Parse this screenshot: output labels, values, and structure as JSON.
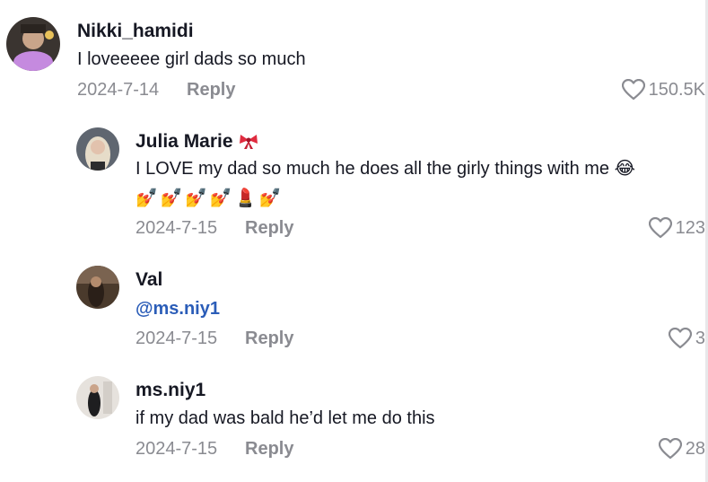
{
  "comments": [
    {
      "username": "Nikki_hamidi",
      "text": "I loveeeee girl dads so much",
      "date": "2024-7-14",
      "reply_label": "Reply",
      "likes": "150.5K"
    },
    {
      "username": "Julia Marie",
      "text_line1": "I LOVE my dad so much he does all the girly things with me 😂",
      "emoji_row": [
        "💅",
        "💅",
        "💅",
        "💅",
        "💄",
        "💅"
      ],
      "date": "2024-7-15",
      "reply_label": "Reply",
      "likes": "123"
    },
    {
      "username": "Val",
      "mention": "@ms.niy1",
      "date": "2024-7-15",
      "reply_label": "Reply",
      "likes": "3"
    },
    {
      "username": "ms.niy1",
      "text": "if my dad was bald he’d let me do this",
      "date": "2024-7-15",
      "reply_label": "Reply",
      "likes": "28"
    }
  ],
  "colors": {
    "text": "#161823",
    "muted": "#8a8b91",
    "mention": "#2b5db8"
  },
  "icons": {
    "like": "heart-outline-icon",
    "badge": "ribbon-bow-icon"
  }
}
